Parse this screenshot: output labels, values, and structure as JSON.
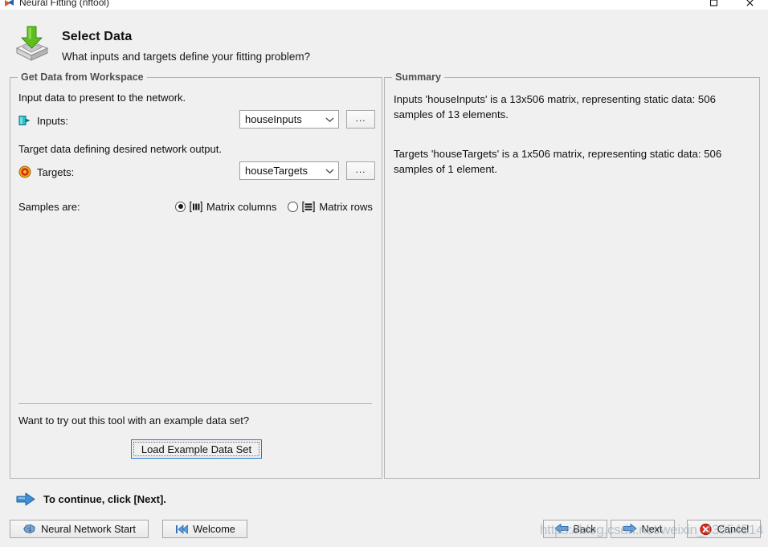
{
  "window": {
    "title": "Neural Fitting (nftool)",
    "icon": "matlab-nn-icon",
    "controls": {
      "maximize": "maximize-icon",
      "close": "close-icon"
    }
  },
  "header": {
    "icon": "import-data-icon",
    "title": "Select Data",
    "subtitle": "What inputs and targets define your fitting problem?"
  },
  "left_panel": {
    "legend": "Get Data from Workspace",
    "input_description": "Input data to present to the network.",
    "inputs_label": "Inputs:",
    "inputs_icon": "input-port-icon",
    "inputs_value": "houseInputs",
    "inputs_browse_label": "...",
    "target_description": "Target data defining desired network output.",
    "targets_label": "Targets:",
    "targets_icon": "target-bullseye-icon",
    "targets_value": "houseTargets",
    "targets_browse_label": "...",
    "samples_label": "Samples are:",
    "sample_options": [
      {
        "label": "Matrix columns",
        "icon": "matrix-columns-icon",
        "selected": true
      },
      {
        "label": "Matrix rows",
        "icon": "matrix-rows-icon",
        "selected": false
      }
    ],
    "example_prompt": "Want to try out this tool with an example data set?",
    "load_example_label": "Load Example Data Set"
  },
  "right_panel": {
    "legend": "Summary",
    "inputs_summary": "Inputs 'houseInputs' is a 13x506 matrix, representing static data: 506 samples of 13 elements.",
    "targets_summary": "Targets 'houseTargets' is a 1x506 matrix, representing static data: 506 samples of 1 element."
  },
  "footer": {
    "continue_icon": "blue-right-arrow-icon",
    "continue_text": "To continue, click [Next].",
    "neural_network_start_label": "Neural Network Start",
    "neural_network_start_icon": "brain-icon",
    "welcome_label": "Welcome",
    "welcome_icon": "rewind-icon",
    "back_label": "Back",
    "back_icon": "blue-left-arrow-icon",
    "next_label": "Next",
    "next_icon": "blue-right-arrow-icon",
    "cancel_label": "Cancel",
    "cancel_icon": "red-cancel-icon"
  },
  "watermark": {
    "text": "https://blog.csdn.net/weixin_43554514"
  },
  "colors": {
    "window_background": "#f0f0f0",
    "group_border": "#b4b4b4",
    "legend_text": "#505050",
    "accent_blue": "#2579d2",
    "import_green": "#62bb23",
    "target_red": "#dd2211",
    "input_teal": "#27c1c8"
  }
}
